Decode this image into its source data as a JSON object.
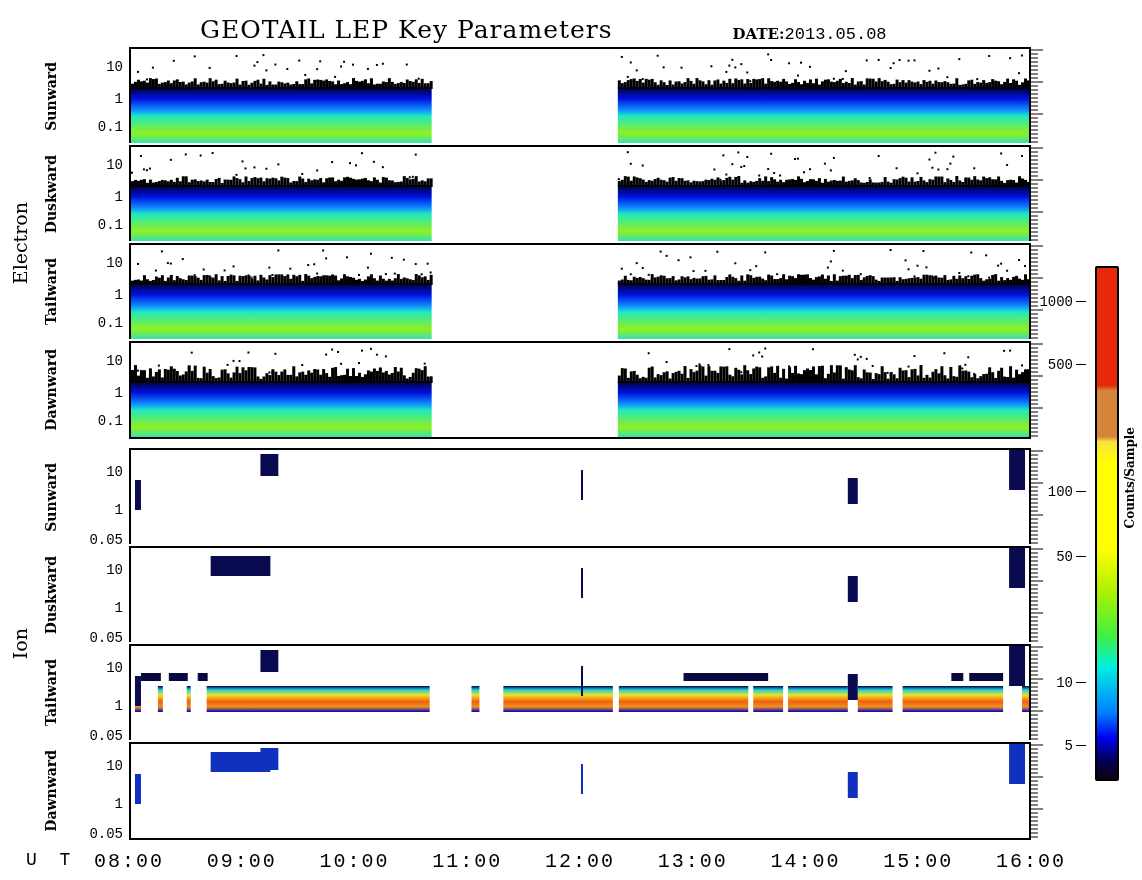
{
  "title": "GEOTAIL LEP Key Parameters",
  "date": {
    "label": "DATE:",
    "value": "2013.05.08"
  },
  "groups": [
    {
      "label": "Electron",
      "kind": "electron",
      "panels": [
        {
          "label": "Sunward",
          "y_ticks": [
            "10",
            "1",
            "0.1"
          ]
        },
        {
          "label": "Duskward",
          "y_ticks": [
            "10",
            "1",
            "0.1"
          ]
        },
        {
          "label": "Tailward",
          "y_ticks": [
            "10",
            "1",
            "0.1"
          ]
        },
        {
          "label": "Dawnward",
          "y_ticks": [
            "10",
            "1",
            "0.1"
          ]
        }
      ]
    },
    {
      "label": "Ion",
      "kind": "ion",
      "panels": [
        {
          "label": "Sunward",
          "y_ticks": [
            "10",
            "1",
            "0.05"
          ]
        },
        {
          "label": "Duskward",
          "y_ticks": [
            "10",
            "1",
            "0.05"
          ]
        },
        {
          "label": "Tailward",
          "y_ticks": [
            "10",
            "1",
            "0.05"
          ]
        },
        {
          "label": "Dawnward",
          "y_ticks": [
            "10",
            "1",
            "0.05"
          ]
        }
      ]
    }
  ],
  "x_axis": {
    "label": "U T",
    "ticks": [
      "08:00",
      "09:00",
      "10:00",
      "11:00",
      "12:00",
      "13:00",
      "14:00",
      "15:00",
      "16:00"
    ]
  },
  "colorbar": {
    "label": "Counts/Sample",
    "ticks": [
      "1000",
      "500",
      "100",
      "50",
      "10",
      "5"
    ]
  }
}
